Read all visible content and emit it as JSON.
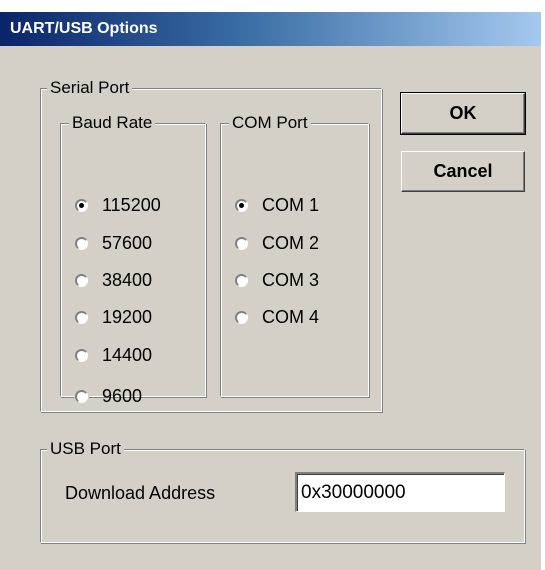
{
  "window": {
    "title": "UART/USB Options"
  },
  "serial_port": {
    "label": "Serial Port",
    "baud_rate": {
      "label": "Baud Rate",
      "options": [
        "115200",
        "57600",
        "38400",
        "19200",
        "14400",
        "9600"
      ],
      "selected": "115200"
    },
    "com_port": {
      "label": "COM Port",
      "options": [
        "COM 1",
        "COM 2",
        "COM 3",
        "COM 4"
      ],
      "selected": "COM 1"
    }
  },
  "buttons": {
    "ok": "OK",
    "cancel": "Cancel"
  },
  "usb_port": {
    "label": "USB Port",
    "download_address_label": "Download Address",
    "download_address_value": "0x30000000"
  },
  "colors": {
    "face": "#d4d0c8",
    "title_start": "#0a246a",
    "title_end": "#a6caf0"
  }
}
